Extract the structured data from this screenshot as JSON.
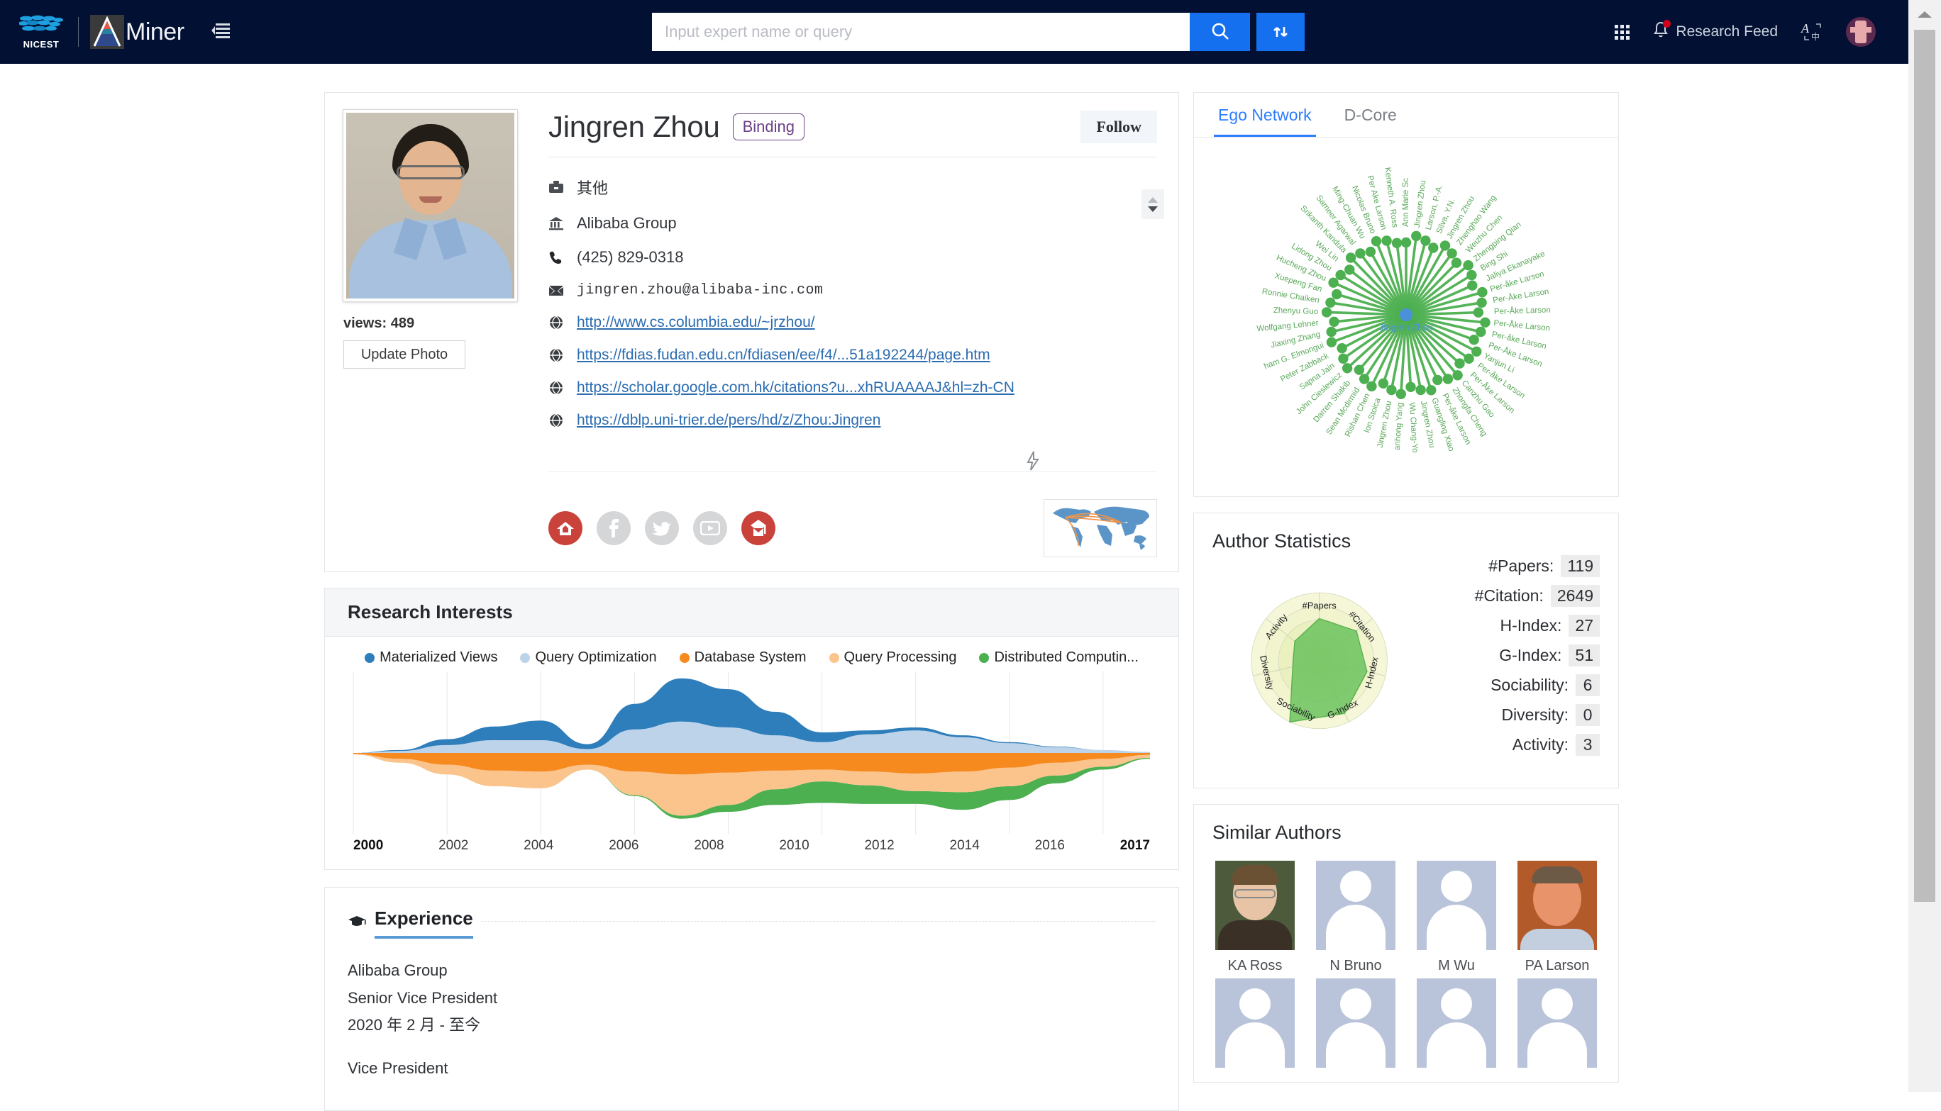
{
  "brand": {
    "nicest_label": "NICEST",
    "aminer_label": "Miner",
    "menu_icon": "hamburger-icon"
  },
  "search": {
    "placeholder": "Input expert name or query",
    "value": "",
    "search_icon": "search-icon",
    "upload_icon": "upload-swap-icon"
  },
  "navright": {
    "apps_icon": "grid-apps-icon",
    "bell_icon": "bell-icon",
    "feed_label": "Research Feed",
    "lang_label": "A中",
    "avatar_icon": "user-avatar"
  },
  "profile": {
    "name": "Jingren Zhou",
    "binding_label": "Binding",
    "follow_label": "Follow",
    "views_label": "views:",
    "views_count": "489",
    "update_photo_label": "Update Photo",
    "position": "其他",
    "affiliation": "Alibaba Group",
    "phone": "(425) 829-0318",
    "email": "jingren.zhou@alibaba-inc.com",
    "links": [
      "http://www.cs.columbia.edu/~jrzhou/",
      "https://fdias.fudan.edu.cn/fdiasen/ee/f4/...51a192244/page.htm",
      "https://scholar.google.com.hk/citations?u...xhRUAAAAJ&hl=zh-CN",
      "https://dblp.uni-trier.de/pers/hd/z/Zhou:Jingren"
    ],
    "social": [
      {
        "name": "homepage-icon",
        "style": "red"
      },
      {
        "name": "facebook-icon",
        "style": "gray"
      },
      {
        "name": "twitter-icon",
        "style": "gray"
      },
      {
        "name": "youtube-icon",
        "style": "gray"
      },
      {
        "name": "scholar-mail-icon",
        "style": "red"
      }
    ],
    "map_thumb_name": "world-map-thumbnail"
  },
  "research_interests": {
    "title": "Research Interests"
  },
  "experience": {
    "title": "Experience",
    "entries": [
      {
        "org": "Alibaba Group",
        "role": "Senior Vice President",
        "period": "2020 年 2 月 - 至今"
      },
      {
        "org": "",
        "role": "Vice President",
        "period": ""
      }
    ]
  },
  "ego_panel": {
    "tabs": [
      {
        "label": "Ego Network",
        "active": true
      },
      {
        "label": "D-Core",
        "active": false
      }
    ],
    "center_label": "Jingren Zhou",
    "node_color": "#4caf50",
    "center_color": "#4a90d9",
    "neighbors": [
      "Ann Marie Sc",
      "Jingren Zhou",
      "Larson, P.-A.",
      "Silva, Y.N.",
      "Jingren Zhou",
      "Zhenghao Wang",
      "Weizhu Chen",
      "Zhengping Qian",
      "Bing Shi",
      "Jaliya Ekanayake",
      "Per-åke Larson",
      "Per-Åke Larson",
      "Per-Åke Larson",
      "Per-Åke Larson",
      "Per-åke Larson",
      "Per-Åke Larson",
      "Yanjun Li",
      "Per-åke Larson",
      "Per-Åke Larson",
      "Canzhu Gao",
      "Zhongfa Cheng",
      "Per-åke Larson",
      "Guangling Xiao",
      "Jingren Zhou",
      "Wu Chang-Yo",
      "anhong Yang",
      "Jingren Zhou",
      "Ion Stoica",
      "Rishan Chen",
      "Sean Mcdirmid",
      "Darren Shakib",
      "John Cieslewicz",
      "Sapna Jain",
      "Peter Zabback",
      "ham G. Elmongui",
      "Jiaxing Zhang",
      "Wolfgang Lehner",
      "Zhenyu Guo",
      "Ronnie Chaiken",
      "Xuepeng Fan",
      "Hucheng Zhou",
      "Lidong Zhou",
      "Wei Lin",
      "Srikanth Kandula",
      "Sameer Agarwal",
      "Ming-Chuan Wu",
      "Nicolas Bruno",
      "Per Ake Larson",
      "Kenneth A. Ross"
    ]
  },
  "author_statistics": {
    "title": "Author Statistics",
    "metrics": [
      {
        "label": "#Papers:",
        "value": "119"
      },
      {
        "label": "#Citation:",
        "value": "2649"
      },
      {
        "label": "H-Index:",
        "value": "27"
      },
      {
        "label": "G-Index:",
        "value": "51"
      },
      {
        "label": "Sociability:",
        "value": "6"
      },
      {
        "label": "Diversity:",
        "value": "0"
      },
      {
        "label": "Activity:",
        "value": "3"
      }
    ],
    "radar_axes": [
      "#Papers",
      "#Citation",
      "H-Index",
      "G-Index",
      "Sociability",
      "Diversity",
      "Activity"
    ]
  },
  "similar_authors": {
    "title": "Similar Authors",
    "people": [
      {
        "name": "KA Ross",
        "has_photo": true,
        "photo_style": "photo1"
      },
      {
        "name": "N Bruno",
        "has_photo": false,
        "photo_style": ""
      },
      {
        "name": "M Wu",
        "has_photo": false,
        "photo_style": ""
      },
      {
        "name": "PA Larson",
        "has_photo": true,
        "photo_style": "photo2"
      }
    ]
  },
  "chart_data": {
    "type": "area",
    "title": "Research Interests",
    "xlabel": "",
    "ylabel": "",
    "x": [
      2000,
      2001,
      2002,
      2003,
      2004,
      2005,
      2006,
      2007,
      2008,
      2009,
      2010,
      2011,
      2012,
      2013,
      2014,
      2015,
      2016,
      2017
    ],
    "tick_labels": [
      "2000",
      "2002",
      "2004",
      "2006",
      "2008",
      "2010",
      "2012",
      "2014",
      "2016",
      "2017"
    ],
    "grid": true,
    "legend_position": "top",
    "stream_baseline": "wiggle",
    "series": [
      {
        "name": "Materialized Views",
        "color": "#2e7ebb",
        "values": [
          0,
          0.1,
          0.6,
          1.4,
          2.0,
          0.5,
          2.6,
          4.4,
          3.9,
          2.4,
          1.0,
          0.4,
          0.3,
          0.2,
          0.1,
          0.05,
          0.0,
          0.0
        ]
      },
      {
        "name": "Query Optimization",
        "color": "#bdd3ea",
        "values": [
          0,
          0.2,
          0.8,
          1.3,
          1.3,
          0.4,
          2.4,
          3.2,
          2.6,
          1.8,
          1.1,
          1.9,
          2.3,
          1.6,
          1.0,
          0.6,
          0.3,
          0.1
        ]
      },
      {
        "name": "Database System",
        "color": "#f78a1e",
        "values": [
          0.1,
          0.6,
          1.2,
          1.8,
          1.9,
          1.2,
          1.9,
          2.2,
          2.0,
          1.8,
          1.7,
          1.9,
          2.1,
          1.9,
          1.5,
          1.0,
          0.6,
          0.2
        ]
      },
      {
        "name": "Query Processing",
        "color": "#fac48c",
        "values": [
          0.05,
          0.4,
          1.0,
          1.6,
          1.7,
          0.5,
          2.4,
          4.2,
          3.3,
          1.9,
          1.2,
          1.4,
          1.8,
          2.1,
          1.9,
          1.3,
          0.8,
          0.3
        ]
      },
      {
        "name": "Distributed Computin...",
        "color": "#4caf50",
        "values": [
          0,
          0,
          0,
          0,
          0,
          0,
          0.1,
          0.3,
          0.7,
          1.6,
          2.2,
          1.9,
          1.3,
          1.8,
          1.4,
          0.8,
          0.3,
          0.1
        ]
      }
    ]
  }
}
